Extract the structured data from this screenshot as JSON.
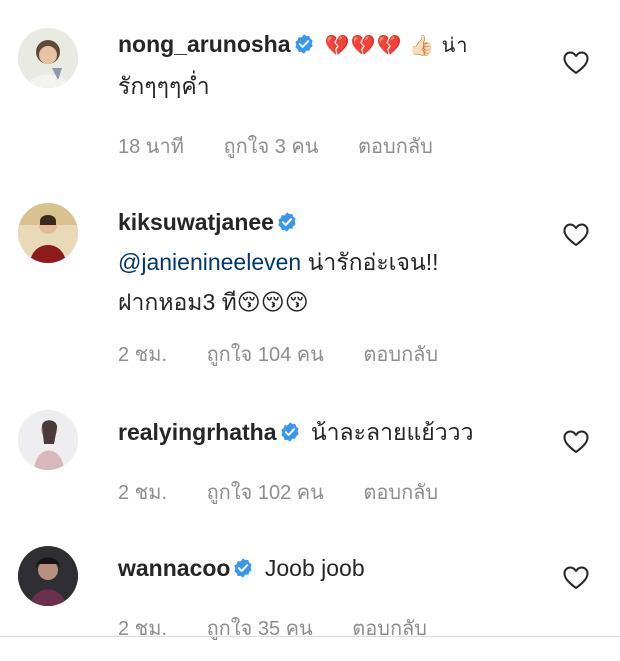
{
  "comments": [
    {
      "username": "nong_arunosha",
      "text_line1": "💔💔💔 👍🏻 น่า",
      "text_line2": "รักๆๆๆค่ำ",
      "time": "18 นาที",
      "likes": "ถูกใจ 3 คน",
      "reply": "ตอบกลับ"
    },
    {
      "username": "kiksuwatjanee",
      "mention": "@janienineeleven",
      "text_line1": " น่ารักอ่ะเจน!!",
      "text_line2": "ฝากหอม3 ที😚😚😚",
      "time": "2 ชม.",
      "likes": "ถูกใจ 104 คน",
      "reply": "ตอบกลับ"
    },
    {
      "username": "realyingrhatha",
      "text_line1": "น้าละลายแย้ววว",
      "time": "2 ชม.",
      "likes": "ถูกใจ 102 คน",
      "reply": "ตอบกลับ"
    },
    {
      "username": "wannacoo",
      "text_line1": "Joob joob",
      "time": "2 ชม.",
      "likes": "ถูกใจ 35 คน",
      "reply": "ตอบกลับ"
    }
  ],
  "icons": {
    "verified": "verified-badge-icon",
    "like": "heart-outline-icon"
  },
  "colors": {
    "text": "#262626",
    "secondary": "#8e8e8e",
    "verified": "#3897f0",
    "mention": "#00376b"
  }
}
